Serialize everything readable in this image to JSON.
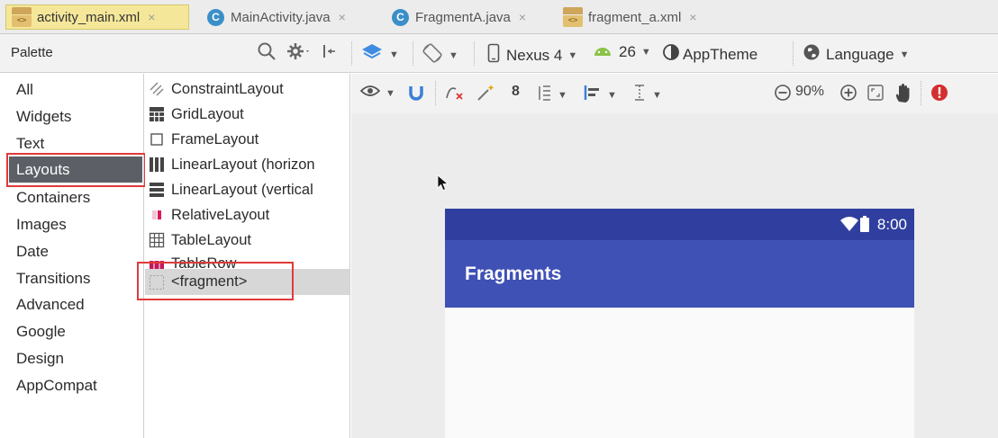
{
  "tabs": [
    {
      "label": "activity_main.xml",
      "icon": "xml-file-icon",
      "active": true
    },
    {
      "label": "MainActivity.java",
      "icon": "java-class-icon",
      "active": false
    },
    {
      "label": "FragmentA.java",
      "icon": "java-class-icon",
      "active": false
    },
    {
      "label": "fragment_a.xml",
      "icon": "xml-file-icon",
      "active": false
    }
  ],
  "tab_close_glyph": "×",
  "xml_glyph": "<>",
  "java_glyph": "C",
  "palette": {
    "title": "Palette"
  },
  "toolbar": {
    "device": "Nexus 4",
    "api": "26",
    "theme": "AppTheme",
    "language": "Language"
  },
  "categories": [
    {
      "label": "All"
    },
    {
      "label": "Widgets"
    },
    {
      "label": "Text"
    },
    {
      "label": "Layouts",
      "selected": true
    },
    {
      "label": "Containers"
    },
    {
      "label": "Images"
    },
    {
      "label": "Date"
    },
    {
      "label": "Transitions"
    },
    {
      "label": "Advanced"
    },
    {
      "label": "Google"
    },
    {
      "label": "Design"
    },
    {
      "label": "AppCompat"
    }
  ],
  "widgets": [
    {
      "label": "ConstraintLayout",
      "icon": "constraint-layout-icon"
    },
    {
      "label": "GridLayout",
      "icon": "grid-layout-icon"
    },
    {
      "label": "FrameLayout",
      "icon": "frame-layout-icon"
    },
    {
      "label": "LinearLayout (horizon",
      "icon": "linear-horizontal-icon"
    },
    {
      "label": "LinearLayout (vertical",
      "icon": "linear-vertical-icon"
    },
    {
      "label": "RelativeLayout",
      "icon": "relative-layout-icon"
    },
    {
      "label": "TableLayout",
      "icon": "table-layout-icon"
    },
    {
      "label": "TableRow",
      "icon": "table-row-icon"
    },
    {
      "label": "<fragment>",
      "icon": "fragment-icon",
      "selected": true
    }
  ],
  "design_toolbar": {
    "default_margin": "8",
    "zoom": "90%"
  },
  "preview": {
    "time": "8:00",
    "app_title": "Fragments",
    "colors": {
      "status_bar": "#303f9f",
      "app_bar": "#3f51b5"
    }
  }
}
